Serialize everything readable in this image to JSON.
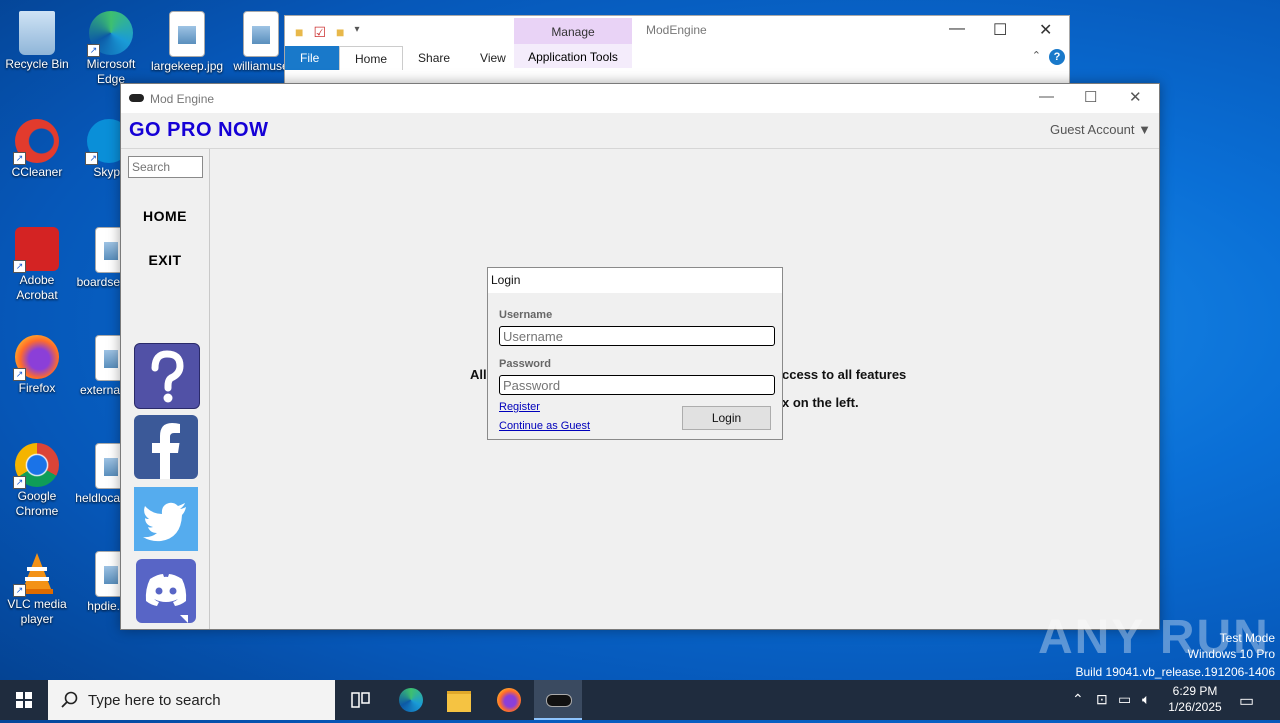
{
  "desktop": {
    "icons": [
      {
        "label": "Recycle Bin"
      },
      {
        "label": "Microsoft Edge"
      },
      {
        "label": "largekeep.jpg"
      },
      {
        "label": "williamuse"
      },
      {
        "label": "CCleaner"
      },
      {
        "label": "Skyp"
      },
      {
        "label": "Adobe Acrobat"
      },
      {
        "label": "boardse"
      },
      {
        "label": "Firefox"
      },
      {
        "label": "externa"
      },
      {
        "label": "Google Chrome"
      },
      {
        "label": "heldloca"
      },
      {
        "label": "VLC media player"
      },
      {
        "label": "hpdie."
      }
    ]
  },
  "explorer": {
    "manage_label": "Manage",
    "app_tools_label": "Application Tools",
    "title": "ModEngine",
    "tabs": [
      "File",
      "Home",
      "Share",
      "View"
    ]
  },
  "mod_window": {
    "title": "Mod Engine",
    "brand": "GO PRO NOW",
    "account": "Guest Account ▼",
    "search_placeholder": "Search",
    "nav": {
      "home": "HOME",
      "exit": "EXIT"
    },
    "content": {
      "line1_start": "All",
      "line1_end": "ccess to all features",
      "line2_end": "x on the left."
    },
    "colors": {
      "brand": "#1500d6"
    }
  },
  "login": {
    "title": "Login",
    "username_label": "Username",
    "username_placeholder": "Username",
    "password_label": "Password",
    "password_placeholder": "Password",
    "register_link": "Register",
    "guest_link": "Continue as Guest",
    "login_button": "Login"
  },
  "watermark": {
    "brand": "ANY RUN",
    "test_mode": "Test Mode",
    "edition": "Windows 10 Pro",
    "build": "Build 19041.vb_release.191206-1406"
  },
  "taskbar": {
    "search_placeholder": "Type here to search",
    "time": "6:29 PM",
    "date": "1/26/2025"
  }
}
